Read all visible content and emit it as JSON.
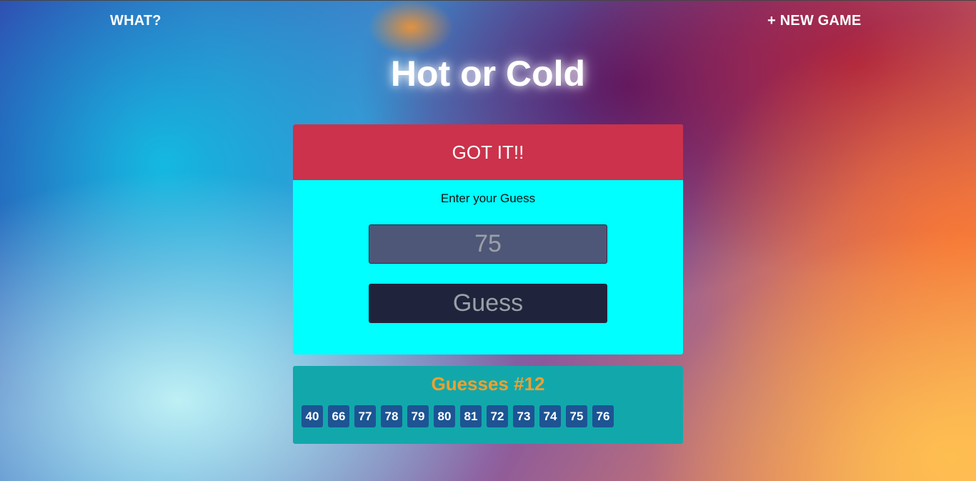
{
  "nav": {
    "what_label": "WHAT?",
    "new_game_label": "+ NEW GAME"
  },
  "header": {
    "title": "Hot or Cold"
  },
  "game": {
    "feedback": "GOT IT!!",
    "prompt_label": "Enter your Guess",
    "input_placeholder": "75",
    "input_value": "",
    "guess_button_label": "Guess"
  },
  "history": {
    "title": "Guesses #12",
    "guesses": [
      "40",
      "66",
      "77",
      "78",
      "79",
      "80",
      "81",
      "72",
      "73",
      "74",
      "75",
      "76"
    ]
  },
  "colors": {
    "feedback_bg": "#cc324b",
    "game_bg": "#00ffff",
    "history_bg": "#12a8ab",
    "history_title": "#f0a030",
    "guess_chip_bg": "#1c5494"
  }
}
